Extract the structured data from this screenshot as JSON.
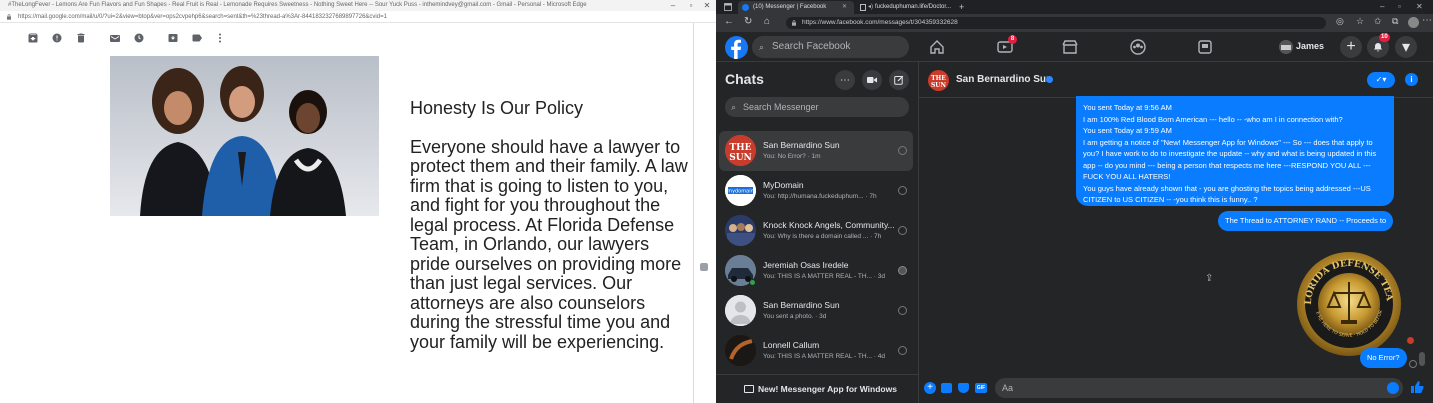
{
  "left_window": {
    "title": "#TheLongFever - Lemons Are Fun Flavors and Fun Shapes - Real Fruit is Real - Lemonade Requires Sweetness - Nothing Sweet Here -- Sour Yuck Puss - inthemindvey@gmail.com - Gmail - Personal - Microsoft Edge",
    "url": "https://mail.google.com/mail/u/0/?ui=2&view=btop&ver=ops2cvpehp6&search=sent&th=%23thread-a%3Ar-8441832327689897726&cvid=1",
    "toolbar_icons": [
      "archive-icon",
      "report-spam-icon",
      "delete-icon",
      "mark-unread-icon",
      "snooze-icon",
      "move-to-icon",
      "label-icon",
      "more-vert-icon"
    ],
    "email": {
      "heading": "Honesty Is Our Policy",
      "body": "Everyone should have a lawyer to protect them and their family. A law firm that is going to listen to you, and fight for you throughout the legal process. At Florida Defense Team, in Orlando, our lawyers pride ourselves on providing more than just legal services. Our attorneys are also counselors during the stressful time you and your family will be experiencing."
    }
  },
  "right_window": {
    "tabs": [
      {
        "label": "(10) Messenger | Facebook"
      },
      {
        "label": "fuckeduphuman.life/Doctor..."
      }
    ],
    "url": "https://www.facebook.com/messages/t/304359332628",
    "fb": {
      "search_placeholder": "Search Facebook",
      "watch_badge": "8",
      "user_name": "James",
      "notif_badge": "10",
      "accent": "#0a7cff"
    },
    "chats": {
      "title": "Chats",
      "search_placeholder": "Search Messenger",
      "items": [
        {
          "name": "San Bernardino Sun",
          "preview": "You: No Error? · 1m",
          "avatar": "sun-logo"
        },
        {
          "name": "MyDomain",
          "preview": "You: http://humana.fuckeduphum... · 7h",
          "avatar": "mydomain-logo"
        },
        {
          "name": "Knock Knock Angels, Community...",
          "preview": "You: Why is there a domain called ... · 7h",
          "avatar": "group-photo"
        },
        {
          "name": "Jeremiah Osas Iredele",
          "preview": "You: THIS IS A MATTER REAL - TH... · 3d",
          "avatar": "car-photo"
        },
        {
          "name": "San Bernardino Sun",
          "preview": "You sent a photo. · 3d",
          "avatar": "default-avatar"
        },
        {
          "name": "Lonnell Callum",
          "preview": "You: THIS IS A MATTER REAL - TH... · 4d",
          "avatar": "dark-photo"
        }
      ],
      "new_app_label": "New! Messenger App for Windows"
    },
    "conversation": {
      "name": "San Bernardino Sun",
      "big_bubble_lines": [
        "You sent Today at 9:56 AM",
        "I am 100% Red Blood Born American --- hello -- -who am I in connection with?",
        "You sent Today at 9:59 AM",
        "I am getting a notice of \"New! Messenger App for Windows\" --- So --- does that apply to you?   I have work to do to investigate the update -- why and what is being updated in this app -- do you mind --- being a person that respects me here ---RESPOND YOU ALL --- FUCK YOU ALL HATERS!",
        "You guys have already shown that - you are ghosting the topics being addressed ---US CITIZEN to US CITIZEN -- -you think this is funny.. ?"
      ],
      "thread_bubble": "The Thread to ATTORNEY RAND -- Proceeds to",
      "seal_top": "FLORIDA DEFENSE TEAM",
      "seal_bottom": "WE'RE HERE TO SERVE · HOLD TO BEFORE",
      "last_bubble": "No Error?",
      "composer_placeholder": "Aa"
    }
  }
}
